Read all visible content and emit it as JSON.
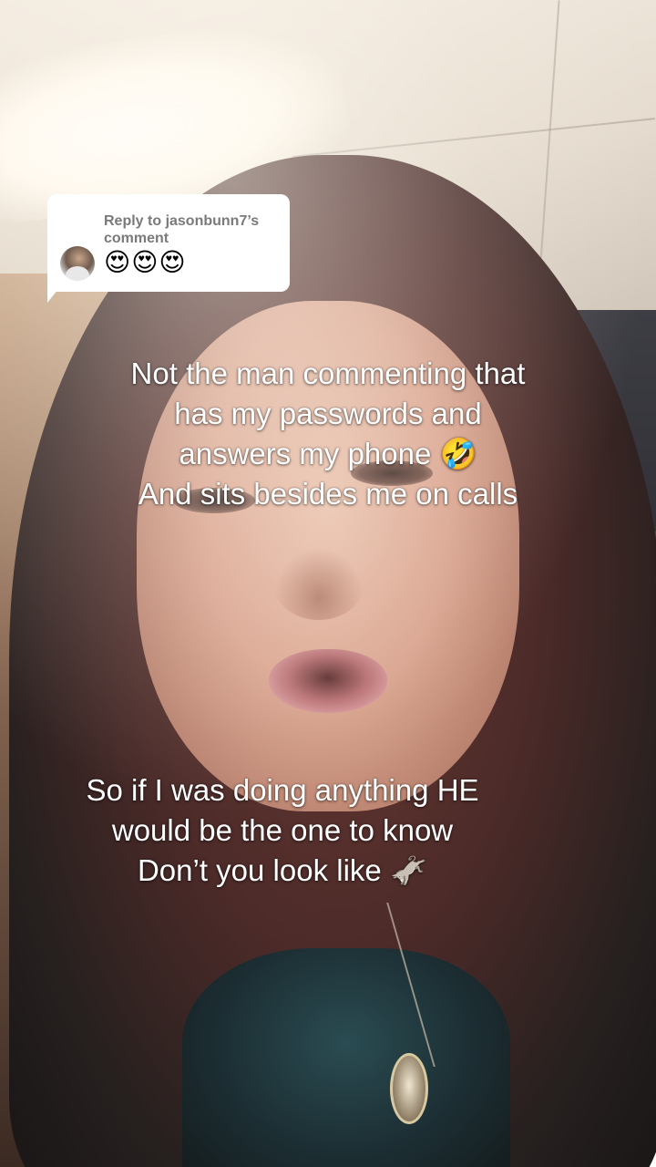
{
  "reply_sticker": {
    "title": "Reply to jasonbunn7’s comment",
    "emojis": "😍😍😍"
  },
  "captions": {
    "top": [
      "Not the man commenting that",
      "has my passwords and",
      "answers my phone 🤣",
      "And sits besides me on calls"
    ],
    "bottom": [
      "So if I was doing anything HE",
      "would be the one to know",
      "Don’t you look like 🫏"
    ]
  },
  "colors": {
    "caption_text": "#ffffff",
    "sticker_background": "#ffffff",
    "sticker_title": "#7a7a7a"
  }
}
